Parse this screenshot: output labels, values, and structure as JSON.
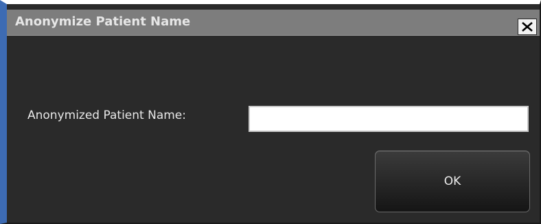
{
  "window": {
    "title": "Anonymize Patient Name",
    "close_icon": "close-icon"
  },
  "form": {
    "label": "Anonymized Patient Name:",
    "value": "",
    "placeholder": ""
  },
  "buttons": {
    "ok_label": "OK"
  },
  "colors": {
    "titlebar": "#7d7d7d",
    "background": "#2a2a2a",
    "accent_border": "#3d6bb3",
    "text": "#e8e8e8"
  }
}
